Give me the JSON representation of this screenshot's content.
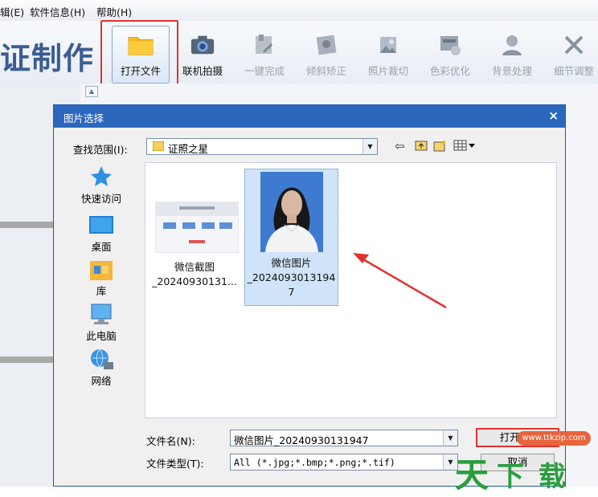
{
  "menubar": {
    "items": [
      "辑(E)",
      "软件信息(H)",
      "帮助(H)"
    ]
  },
  "app": {
    "title": "证制作",
    "toolbar": [
      {
        "label": "打开文件",
        "icon": "folder-icon",
        "active": true
      },
      {
        "label": "联机拍摄",
        "icon": "camera-icon",
        "active": true
      },
      {
        "label": "一键完成",
        "icon": "magic-icon",
        "active": false
      },
      {
        "label": "倾斜矫正",
        "icon": "rotate-icon",
        "active": false
      },
      {
        "label": "照片裁切",
        "icon": "crop-icon",
        "active": false
      },
      {
        "label": "色彩优化",
        "icon": "color-icon",
        "active": false
      },
      {
        "label": "背景处理",
        "icon": "background-icon",
        "active": false
      },
      {
        "label": "细节调整",
        "icon": "tools-icon",
        "active": false
      }
    ]
  },
  "dialog": {
    "title": "图片选择",
    "close": "×",
    "lookin_label": "查找范围(I):",
    "lookin_value": "证照之星",
    "places": [
      "快速访问",
      "桌面",
      "库",
      "此电脑",
      "网络"
    ],
    "files": [
      {
        "name_lines": [
          "微信截图",
          "_20240930131..."
        ],
        "thumbnail": "screenshot",
        "selected": false
      },
      {
        "name_lines": [
          "微信图片",
          "_2024093013194",
          "7"
        ],
        "thumbnail": "portrait",
        "selected": true
      }
    ],
    "filename_label": "文件名(N):",
    "filename_value": "微信图片_20240930131947",
    "filetype_label": "文件类型(T):",
    "filetype_value": "All (*.jpg;*.bmp;*.png;*.tif)",
    "open_button": "打开(O)",
    "cancel_button": "取消"
  },
  "watermark": {
    "url": "www.ttkzip.com",
    "text": "天下载"
  },
  "colors": {
    "dialog_titlebar": "#2b68bd",
    "highlight": "#e0332f",
    "title_text": "#3c5c93"
  }
}
